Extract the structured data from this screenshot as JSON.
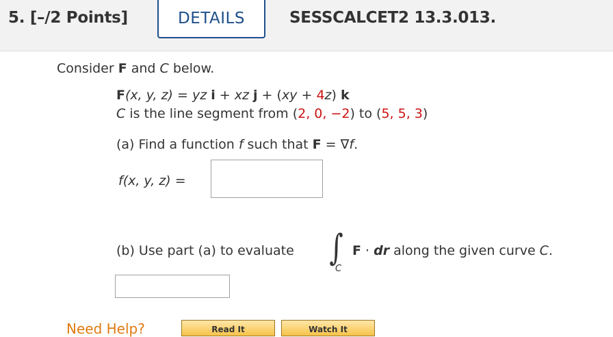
{
  "header": {
    "points": "5.  [–/2 Points]",
    "details_label": "DETAILS",
    "code": "SESSCALCET2 13.3.013."
  },
  "problem": {
    "intro_prefix": "Consider ",
    "intro_F": "F",
    "intro_mid": " and ",
    "intro_C": "C",
    "intro_suffix": " below.",
    "field": {
      "F": "F",
      "args": "(x, y, z) = ",
      "yz": "yz",
      "i": "i",
      "plus1": " + ",
      "xz": "xz",
      "j": "j",
      "plus2": " + (",
      "xy": "xy",
      "plus3": " + ",
      "coef": "4",
      "z": "z",
      "close": ") ",
      "k": "k"
    },
    "segment": {
      "C": "C",
      "text1": " is the line segment from (",
      "p1": "2, 0, −2",
      "text2": ") to (",
      "p2": "5, 5, 3",
      "text3": ")"
    },
    "part_a": {
      "prefix": "(a) Find a function ",
      "f": "f",
      "mid": " such that ",
      "F": "F",
      "eq": " = ∇",
      "f2": "f",
      "dot": ".",
      "label": "f(x, y, z)  =",
      "answer": ""
    },
    "part_b": {
      "prefix": "(b) Use part (a) to evaluate",
      "integral": "∫",
      "sub": "C",
      "F": "F",
      "dot": " · ",
      "dr": "dr",
      "suffix": "  along the given curve ",
      "C": "C",
      "period": ".",
      "answer": ""
    }
  },
  "help": {
    "label": "Need Help?",
    "read_it": "Read It",
    "watch_it": "Watch It"
  },
  "colors": {
    "accent": "#1e4f8a",
    "highlight": "#cc1111",
    "help": "#e07a10"
  }
}
